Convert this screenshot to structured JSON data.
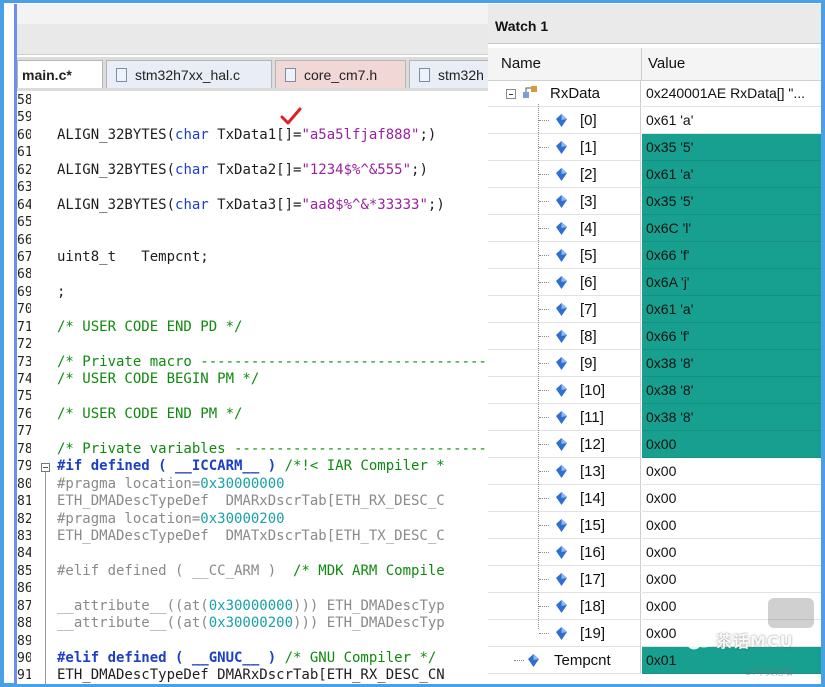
{
  "editor": {
    "top_strip_text": "",
    "tabs": [
      {
        "label": "main.c*",
        "active": true
      },
      {
        "label": "stm32h7xx_hal.c",
        "active": false
      },
      {
        "label": "core_cm7.h",
        "active": false
      },
      {
        "label": "stm32h",
        "active": false
      }
    ],
    "line_numbers": [
      "58",
      "59",
      "60",
      "61",
      "62",
      "63",
      "64",
      "65",
      "66",
      "67",
      "68",
      "69",
      "70",
      "71",
      "72",
      "73",
      "74",
      "75",
      "76",
      "77",
      "78",
      "79",
      "80",
      "81",
      "82",
      "83",
      "84",
      "85",
      "86",
      "87",
      "88",
      "89",
      "90",
      "91"
    ],
    "code_lines": [
      [],
      [],
      [
        {
          "t": "ALIGN_32BYTES(",
          "c": "plain"
        },
        {
          "t": "char",
          "c": "kw"
        },
        {
          "t": " TxData1[]=",
          "c": "plain"
        },
        {
          "t": "\"a5a5lfjaf888\"",
          "c": "str"
        },
        {
          "t": ";)",
          "c": "plain"
        }
      ],
      [],
      [
        {
          "t": "ALIGN_32BYTES(",
          "c": "plain"
        },
        {
          "t": "char",
          "c": "kw"
        },
        {
          "t": " TxData2[]=",
          "c": "plain"
        },
        {
          "t": "\"1234$%^&555\"",
          "c": "str"
        },
        {
          "t": ";)",
          "c": "plain"
        }
      ],
      [],
      [
        {
          "t": "ALIGN_32BYTES(",
          "c": "plain"
        },
        {
          "t": "char",
          "c": "kw"
        },
        {
          "t": " TxData3[]=",
          "c": "plain"
        },
        {
          "t": "\"aa8$%^&*33333\"",
          "c": "str"
        },
        {
          "t": ";)",
          "c": "plain"
        }
      ],
      [],
      [],
      [
        {
          "t": "uint8_t   Tempcnt;",
          "c": "plain"
        }
      ],
      [],
      [
        {
          "t": ";",
          "c": "plain"
        }
      ],
      [],
      [
        {
          "t": "/* USER CODE END PD */",
          "c": "com"
        }
      ],
      [],
      [
        {
          "t": "/* Private macro ------------------------------------",
          "c": "com"
        }
      ],
      [
        {
          "t": "/* USER CODE BEGIN PM */",
          "c": "com"
        }
      ],
      [],
      [
        {
          "t": "/* USER CODE END PM */",
          "c": "com"
        }
      ],
      [],
      [
        {
          "t": "/* Private variables --------------------------------",
          "c": "com"
        }
      ],
      [
        {
          "t": "#if defined ( __ICCARM__ ) ",
          "c": "pre"
        },
        {
          "t": "/*!< IAR Compiler *",
          "c": "com"
        }
      ],
      [
        {
          "t": "#pragma location=",
          "c": "gray"
        },
        {
          "t": "0x30000000",
          "c": "num"
        }
      ],
      [
        {
          "t": "ETH_DMADescTypeDef  DMARxDscrTab[ETH_RX_DESC_C",
          "c": "gray"
        }
      ],
      [
        {
          "t": "#pragma location=",
          "c": "gray"
        },
        {
          "t": "0x30000200",
          "c": "num"
        }
      ],
      [
        {
          "t": "ETH_DMADescTypeDef  DMATxDscrTab[ETH_TX_DESC_C",
          "c": "gray"
        }
      ],
      [],
      [
        {
          "t": "#elif defined ( __CC_ARM )  ",
          "c": "gray"
        },
        {
          "t": "/* MDK ARM Compile",
          "c": "com"
        }
      ],
      [],
      [
        {
          "t": "__attribute__((at(",
          "c": "gray"
        },
        {
          "t": "0x30000000",
          "c": "num"
        },
        {
          "t": "))) ETH_DMADescTyp",
          "c": "gray"
        }
      ],
      [
        {
          "t": "__attribute__((at(",
          "c": "gray"
        },
        {
          "t": "0x30000200",
          "c": "num"
        },
        {
          "t": "))) ETH_DMADescTyp",
          "c": "gray"
        }
      ],
      [],
      [
        {
          "t": "#elif defined ( __GNUC__ ) ",
          "c": "pre"
        },
        {
          "t": "/* GNU Compiler */",
          "c": "com"
        }
      ],
      [
        {
          "t": "ETH_DMADescTypeDef DMARxDscrTab[ETH_RX_DESC_CN",
          "c": "plain"
        }
      ]
    ]
  },
  "watch": {
    "title": "Watch 1",
    "col_name": "Name",
    "col_value": "Value",
    "root": {
      "name": "RxData",
      "value": "0x240001AE RxData[] \"..."
    },
    "items": [
      {
        "name": "[0]",
        "value": "0x61 'a'",
        "changed": false
      },
      {
        "name": "[1]",
        "value": "0x35 '5'",
        "changed": true
      },
      {
        "name": "[2]",
        "value": "0x61 'a'",
        "changed": true
      },
      {
        "name": "[3]",
        "value": "0x35 '5'",
        "changed": true
      },
      {
        "name": "[4]",
        "value": "0x6C 'l'",
        "changed": true
      },
      {
        "name": "[5]",
        "value": "0x66 'f'",
        "changed": true
      },
      {
        "name": "[6]",
        "value": "0x6A 'j'",
        "changed": true
      },
      {
        "name": "[7]",
        "value": "0x61 'a'",
        "changed": true
      },
      {
        "name": "[8]",
        "value": "0x66 'f'",
        "changed": true
      },
      {
        "name": "[9]",
        "value": "0x38 '8'",
        "changed": true
      },
      {
        "name": "[10]",
        "value": "0x38 '8'",
        "changed": true
      },
      {
        "name": "[11]",
        "value": "0x38 '8'",
        "changed": true
      },
      {
        "name": "[12]",
        "value": "0x00",
        "changed": true
      },
      {
        "name": "[13]",
        "value": "0x00",
        "changed": false
      },
      {
        "name": "[14]",
        "value": "0x00",
        "changed": false
      },
      {
        "name": "[15]",
        "value": "0x00",
        "changed": false
      },
      {
        "name": "[16]",
        "value": "0x00",
        "changed": false
      },
      {
        "name": "[17]",
        "value": "0x00",
        "changed": false
      },
      {
        "name": "[18]",
        "value": "0x00",
        "changed": false
      },
      {
        "name": "[19]",
        "value": "0x00",
        "changed": false
      }
    ],
    "tempcnt": {
      "name": "Tempcnt",
      "value": "0x01",
      "changed": true
    }
  },
  "watermark": {
    "text": "茶话MCU",
    "sub": "ST中文论坛"
  },
  "colors": {
    "changed_bg": "#17a090",
    "frame": "#4aa0e6",
    "check": "#e02020"
  }
}
